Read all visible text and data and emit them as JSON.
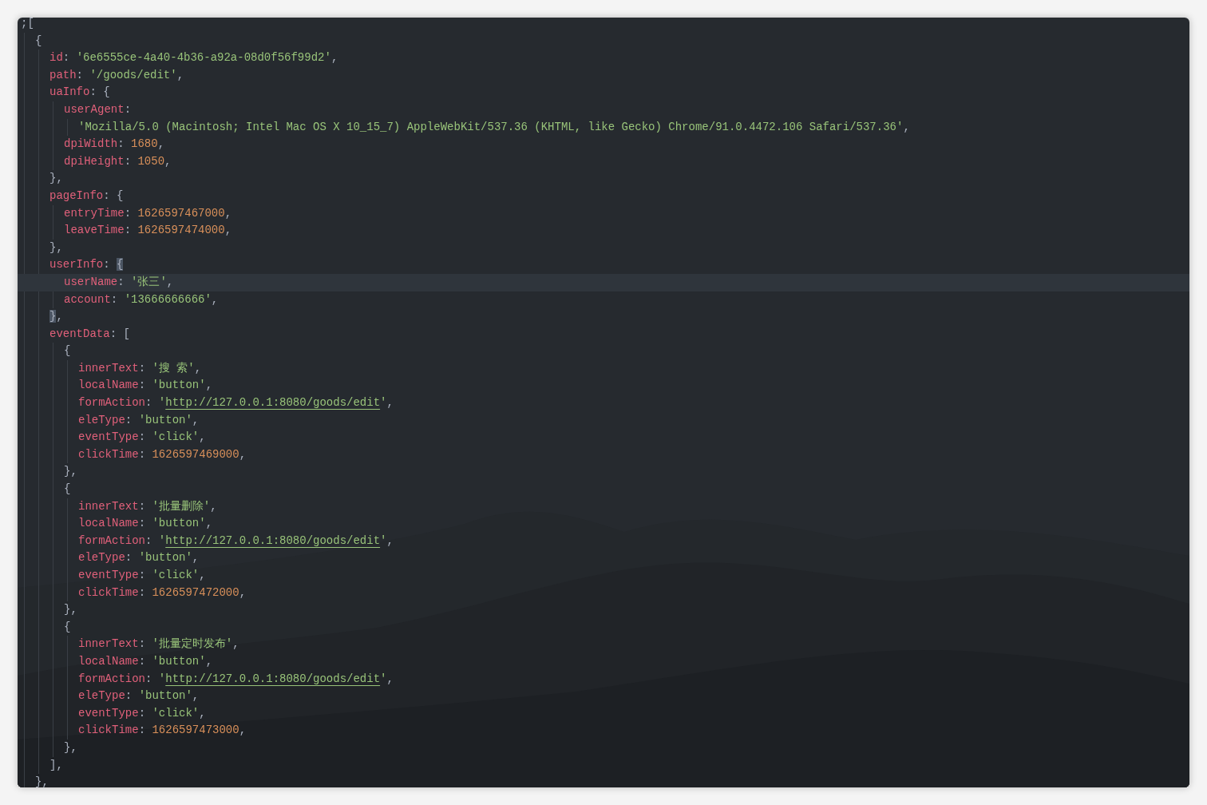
{
  "editor": {
    "lines": [
      {
        "tokens": [
          {
            "kind": "punct",
            "text": ";["
          }
        ],
        "highlighted": false,
        "children": [
          {
            "tokens": [
              {
                "kind": "punct",
                "text": "{"
              }
            ],
            "highlighted": false,
            "children": [
              {
                "tokens": [
                  {
                    "kind": "key",
                    "text": "id"
                  },
                  {
                    "kind": "punct",
                    "text": ": "
                  },
                  {
                    "kind": "string",
                    "text": "'6e6555ce-4a40-4b36-a92a-08d0f56f99d2'"
                  },
                  {
                    "kind": "punct",
                    "text": ","
                  }
                ],
                "highlighted": false
              },
              {
                "tokens": [
                  {
                    "kind": "key",
                    "text": "path"
                  },
                  {
                    "kind": "punct",
                    "text": ": "
                  },
                  {
                    "kind": "string",
                    "text": "'/goods/edit'"
                  },
                  {
                    "kind": "punct",
                    "text": ","
                  }
                ],
                "highlighted": false
              },
              {
                "tokens": [
                  {
                    "kind": "key",
                    "text": "uaInfo"
                  },
                  {
                    "kind": "punct",
                    "text": ": {"
                  }
                ],
                "highlighted": false,
                "children": [
                  {
                    "tokens": [
                      {
                        "kind": "key",
                        "text": "userAgent"
                      },
                      {
                        "kind": "punct",
                        "text": ":"
                      }
                    ],
                    "highlighted": false,
                    "children": [
                      {
                        "tokens": [
                          {
                            "kind": "string",
                            "text": "'Mozilla/5.0 (Macintosh; Intel Mac OS X 10_15_7) AppleWebKit/537.36 (KHTML, like Gecko) Chrome/91.0.4472.106 Safari/537.36'"
                          },
                          {
                            "kind": "punct",
                            "text": ","
                          }
                        ],
                        "highlighted": false
                      }
                    ]
                  },
                  {
                    "tokens": [
                      {
                        "kind": "key",
                        "text": "dpiWidth"
                      },
                      {
                        "kind": "punct",
                        "text": ": "
                      },
                      {
                        "kind": "number",
                        "text": "1680"
                      },
                      {
                        "kind": "punct",
                        "text": ","
                      }
                    ],
                    "highlighted": false
                  },
                  {
                    "tokens": [
                      {
                        "kind": "key",
                        "text": "dpiHeight"
                      },
                      {
                        "kind": "punct",
                        "text": ": "
                      },
                      {
                        "kind": "number",
                        "text": "1050"
                      },
                      {
                        "kind": "punct",
                        "text": ","
                      }
                    ],
                    "highlighted": false
                  }
                ]
              },
              {
                "tokens": [
                  {
                    "kind": "punct",
                    "text": "},"
                  }
                ],
                "highlighted": false
              },
              {
                "tokens": [
                  {
                    "kind": "key",
                    "text": "pageInfo"
                  },
                  {
                    "kind": "punct",
                    "text": ": {"
                  }
                ],
                "highlighted": false,
                "children": [
                  {
                    "tokens": [
                      {
                        "kind": "key",
                        "text": "entryTime"
                      },
                      {
                        "kind": "punct",
                        "text": ": "
                      },
                      {
                        "kind": "number",
                        "text": "1626597467000"
                      },
                      {
                        "kind": "punct",
                        "text": ","
                      }
                    ],
                    "highlighted": false
                  },
                  {
                    "tokens": [
                      {
                        "kind": "key",
                        "text": "leaveTime"
                      },
                      {
                        "kind": "punct",
                        "text": ": "
                      },
                      {
                        "kind": "number",
                        "text": "1626597474000"
                      },
                      {
                        "kind": "punct",
                        "text": ","
                      }
                    ],
                    "highlighted": false
                  }
                ]
              },
              {
                "tokens": [
                  {
                    "kind": "punct",
                    "text": "},"
                  }
                ],
                "highlighted": false
              },
              {
                "tokens": [
                  {
                    "kind": "key",
                    "text": "userInfo"
                  },
                  {
                    "kind": "punct",
                    "text": ": "
                  },
                  {
                    "kind": "bracket_match",
                    "text": "{"
                  }
                ],
                "highlighted": false,
                "children": [
                  {
                    "tokens": [
                      {
                        "kind": "key",
                        "text": "userName"
                      },
                      {
                        "kind": "punct",
                        "text": ": "
                      },
                      {
                        "kind": "string",
                        "text": "'张三'"
                      },
                      {
                        "kind": "punct",
                        "text": ","
                      }
                    ],
                    "highlighted": true
                  },
                  {
                    "tokens": [
                      {
                        "kind": "key",
                        "text": "account"
                      },
                      {
                        "kind": "punct",
                        "text": ": "
                      },
                      {
                        "kind": "string",
                        "text": "'13666666666'"
                      },
                      {
                        "kind": "punct",
                        "text": ","
                      }
                    ],
                    "highlighted": false
                  }
                ]
              },
              {
                "tokens": [
                  {
                    "kind": "bracket_match",
                    "text": "}"
                  },
                  {
                    "kind": "punct",
                    "text": ","
                  }
                ],
                "highlighted": false
              },
              {
                "tokens": [
                  {
                    "kind": "key",
                    "text": "eventData"
                  },
                  {
                    "kind": "punct",
                    "text": ": ["
                  }
                ],
                "highlighted": false,
                "children": [
                  {
                    "tokens": [
                      {
                        "kind": "punct",
                        "text": "{"
                      }
                    ],
                    "highlighted": false,
                    "children": [
                      {
                        "tokens": [
                          {
                            "kind": "key",
                            "text": "innerText"
                          },
                          {
                            "kind": "punct",
                            "text": ": "
                          },
                          {
                            "kind": "string",
                            "text": "'搜 索'"
                          },
                          {
                            "kind": "punct",
                            "text": ","
                          }
                        ],
                        "highlighted": false
                      },
                      {
                        "tokens": [
                          {
                            "kind": "key",
                            "text": "localName"
                          },
                          {
                            "kind": "punct",
                            "text": ": "
                          },
                          {
                            "kind": "string",
                            "text": "'button'"
                          },
                          {
                            "kind": "punct",
                            "text": ","
                          }
                        ],
                        "highlighted": false
                      },
                      {
                        "tokens": [
                          {
                            "kind": "key",
                            "text": "formAction"
                          },
                          {
                            "kind": "punct",
                            "text": ": "
                          },
                          {
                            "kind": "string",
                            "text": "'"
                          },
                          {
                            "kind": "link",
                            "text": "http://127.0.0.1:8080/goods/edit"
                          },
                          {
                            "kind": "string",
                            "text": "'"
                          },
                          {
                            "kind": "punct",
                            "text": ","
                          }
                        ],
                        "highlighted": false
                      },
                      {
                        "tokens": [
                          {
                            "kind": "key",
                            "text": "eleType"
                          },
                          {
                            "kind": "punct",
                            "text": ": "
                          },
                          {
                            "kind": "string",
                            "text": "'button'"
                          },
                          {
                            "kind": "punct",
                            "text": ","
                          }
                        ],
                        "highlighted": false
                      },
                      {
                        "tokens": [
                          {
                            "kind": "key",
                            "text": "eventType"
                          },
                          {
                            "kind": "punct",
                            "text": ": "
                          },
                          {
                            "kind": "string",
                            "text": "'click'"
                          },
                          {
                            "kind": "punct",
                            "text": ","
                          }
                        ],
                        "highlighted": false
                      },
                      {
                        "tokens": [
                          {
                            "kind": "key",
                            "text": "clickTime"
                          },
                          {
                            "kind": "punct",
                            "text": ": "
                          },
                          {
                            "kind": "number",
                            "text": "1626597469000"
                          },
                          {
                            "kind": "punct",
                            "text": ","
                          }
                        ],
                        "highlighted": false
                      }
                    ]
                  },
                  {
                    "tokens": [
                      {
                        "kind": "punct",
                        "text": "},"
                      }
                    ],
                    "highlighted": false
                  },
                  {
                    "tokens": [
                      {
                        "kind": "punct",
                        "text": "{"
                      }
                    ],
                    "highlighted": false,
                    "children": [
                      {
                        "tokens": [
                          {
                            "kind": "key",
                            "text": "innerText"
                          },
                          {
                            "kind": "punct",
                            "text": ": "
                          },
                          {
                            "kind": "string",
                            "text": "'批量删除'"
                          },
                          {
                            "kind": "punct",
                            "text": ","
                          }
                        ],
                        "highlighted": false
                      },
                      {
                        "tokens": [
                          {
                            "kind": "key",
                            "text": "localName"
                          },
                          {
                            "kind": "punct",
                            "text": ": "
                          },
                          {
                            "kind": "string",
                            "text": "'button'"
                          },
                          {
                            "kind": "punct",
                            "text": ","
                          }
                        ],
                        "highlighted": false
                      },
                      {
                        "tokens": [
                          {
                            "kind": "key",
                            "text": "formAction"
                          },
                          {
                            "kind": "punct",
                            "text": ": "
                          },
                          {
                            "kind": "string",
                            "text": "'"
                          },
                          {
                            "kind": "link",
                            "text": "http://127.0.0.1:8080/goods/edit"
                          },
                          {
                            "kind": "string",
                            "text": "'"
                          },
                          {
                            "kind": "punct",
                            "text": ","
                          }
                        ],
                        "highlighted": false
                      },
                      {
                        "tokens": [
                          {
                            "kind": "key",
                            "text": "eleType"
                          },
                          {
                            "kind": "punct",
                            "text": ": "
                          },
                          {
                            "kind": "string",
                            "text": "'button'"
                          },
                          {
                            "kind": "punct",
                            "text": ","
                          }
                        ],
                        "highlighted": false
                      },
                      {
                        "tokens": [
                          {
                            "kind": "key",
                            "text": "eventType"
                          },
                          {
                            "kind": "punct",
                            "text": ": "
                          },
                          {
                            "kind": "string",
                            "text": "'click'"
                          },
                          {
                            "kind": "punct",
                            "text": ","
                          }
                        ],
                        "highlighted": false
                      },
                      {
                        "tokens": [
                          {
                            "kind": "key",
                            "text": "clickTime"
                          },
                          {
                            "kind": "punct",
                            "text": ": "
                          },
                          {
                            "kind": "number",
                            "text": "1626597472000"
                          },
                          {
                            "kind": "punct",
                            "text": ","
                          }
                        ],
                        "highlighted": false
                      }
                    ]
                  },
                  {
                    "tokens": [
                      {
                        "kind": "punct",
                        "text": "},"
                      }
                    ],
                    "highlighted": false
                  },
                  {
                    "tokens": [
                      {
                        "kind": "punct",
                        "text": "{"
                      }
                    ],
                    "highlighted": false,
                    "children": [
                      {
                        "tokens": [
                          {
                            "kind": "key",
                            "text": "innerText"
                          },
                          {
                            "kind": "punct",
                            "text": ": "
                          },
                          {
                            "kind": "string",
                            "text": "'批量定时发布'"
                          },
                          {
                            "kind": "punct",
                            "text": ","
                          }
                        ],
                        "highlighted": false
                      },
                      {
                        "tokens": [
                          {
                            "kind": "key",
                            "text": "localName"
                          },
                          {
                            "kind": "punct",
                            "text": ": "
                          },
                          {
                            "kind": "string",
                            "text": "'button'"
                          },
                          {
                            "kind": "punct",
                            "text": ","
                          }
                        ],
                        "highlighted": false
                      },
                      {
                        "tokens": [
                          {
                            "kind": "key",
                            "text": "formAction"
                          },
                          {
                            "kind": "punct",
                            "text": ": "
                          },
                          {
                            "kind": "string",
                            "text": "'"
                          },
                          {
                            "kind": "link",
                            "text": "http://127.0.0.1:8080/goods/edit"
                          },
                          {
                            "kind": "string",
                            "text": "'"
                          },
                          {
                            "kind": "punct",
                            "text": ","
                          }
                        ],
                        "highlighted": false
                      },
                      {
                        "tokens": [
                          {
                            "kind": "key",
                            "text": "eleType"
                          },
                          {
                            "kind": "punct",
                            "text": ": "
                          },
                          {
                            "kind": "string",
                            "text": "'button'"
                          },
                          {
                            "kind": "punct",
                            "text": ","
                          }
                        ],
                        "highlighted": false
                      },
                      {
                        "tokens": [
                          {
                            "kind": "key",
                            "text": "eventType"
                          },
                          {
                            "kind": "punct",
                            "text": ": "
                          },
                          {
                            "kind": "string",
                            "text": "'click'"
                          },
                          {
                            "kind": "punct",
                            "text": ","
                          }
                        ],
                        "highlighted": false
                      },
                      {
                        "tokens": [
                          {
                            "kind": "key",
                            "text": "clickTime"
                          },
                          {
                            "kind": "punct",
                            "text": ": "
                          },
                          {
                            "kind": "number",
                            "text": "1626597473000"
                          },
                          {
                            "kind": "punct",
                            "text": ","
                          }
                        ],
                        "highlighted": false
                      }
                    ]
                  },
                  {
                    "tokens": [
                      {
                        "kind": "punct",
                        "text": "},"
                      }
                    ],
                    "highlighted": false
                  }
                ]
              },
              {
                "tokens": [
                  {
                    "kind": "punct",
                    "text": "],"
                  }
                ],
                "highlighted": false
              }
            ]
          },
          {
            "tokens": [
              {
                "kind": "punct",
                "text": "},"
              }
            ],
            "highlighted": false
          }
        ]
      }
    ]
  }
}
